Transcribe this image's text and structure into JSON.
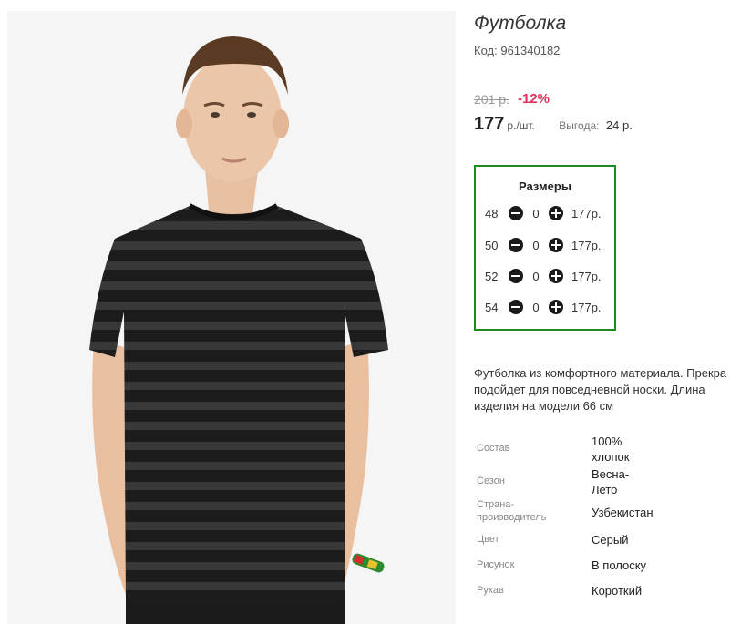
{
  "product": {
    "title": "Футболка",
    "code_label": "Код:",
    "code_value": "961340182",
    "image_alt": "product-photo"
  },
  "pricing": {
    "old_price": "201 р.",
    "discount": "-12%",
    "price": "177",
    "unit": "р./шт.",
    "benefit_label": "Выгода:",
    "benefit_value": "24 р."
  },
  "sizes": {
    "title": "Размеры",
    "rows": [
      {
        "size": "48",
        "qty": "0",
        "price": "177р."
      },
      {
        "size": "50",
        "qty": "0",
        "price": "177р."
      },
      {
        "size": "52",
        "qty": "0",
        "price": "177р."
      },
      {
        "size": "54",
        "qty": "0",
        "price": "177р."
      }
    ],
    "minus_icon": "minus-circle-icon",
    "plus_icon": "plus-circle-icon"
  },
  "description": {
    "lines": [
      "Футболка из комфортного материала. Прекра",
      "подойдет для повседневной носки. Длина",
      "изделия на модели 66 см"
    ]
  },
  "attributes": [
    {
      "label": "Состав",
      "value": "100% хлопок"
    },
    {
      "label": "Сезон",
      "value": "Весна-Лето"
    },
    {
      "label": "Страна-производитель",
      "value": "Узбекистан"
    },
    {
      "label": "Цвет",
      "value": "Серый"
    },
    {
      "label": "Рисунок",
      "value": "В полоску"
    },
    {
      "label": "Рукав",
      "value": "Короткий"
    }
  ],
  "colors": {
    "accent_border": "#1f8a1f",
    "discount": "#e0315b"
  }
}
